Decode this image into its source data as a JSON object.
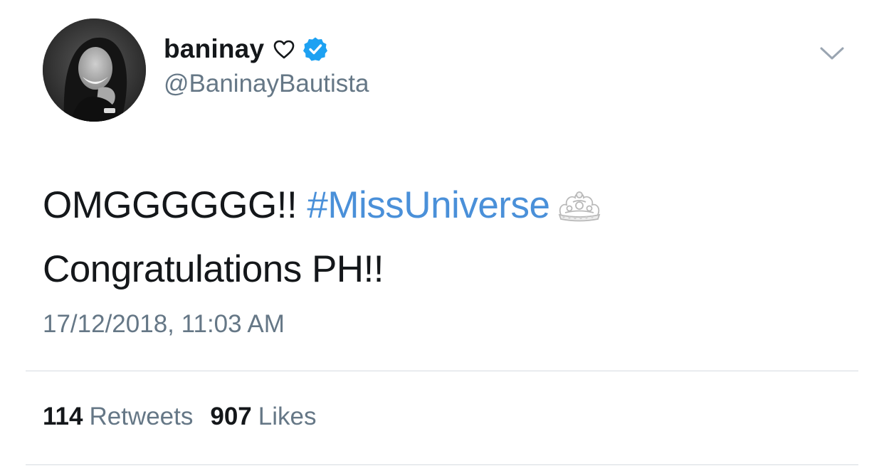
{
  "author": {
    "display_name": "baninay",
    "handle": "@BaninayBautista",
    "verified": true,
    "name_emoji_icon": "heart-outline-icon",
    "avatar_icon": "profile-photo"
  },
  "tweet": {
    "text_prefix": "OMGGGGGG!! ",
    "hashtag": "#MissUniverse",
    "hashtag_emoji_icon": "crown-icon",
    "line2": "Congratulations PH!!",
    "timestamp": "17/12/2018, 11:03 AM"
  },
  "stats": {
    "retweets_count": "114",
    "retweets_label": "Retweets",
    "likes_count": "907",
    "likes_label": "Likes"
  },
  "colors": {
    "link": "#4a90d9",
    "verified": "#1da1f2",
    "secondary_text": "#657786",
    "primary_text": "#14171a",
    "divider": "#d6dbe0"
  },
  "menu": {
    "icon": "chevron-down-icon"
  }
}
